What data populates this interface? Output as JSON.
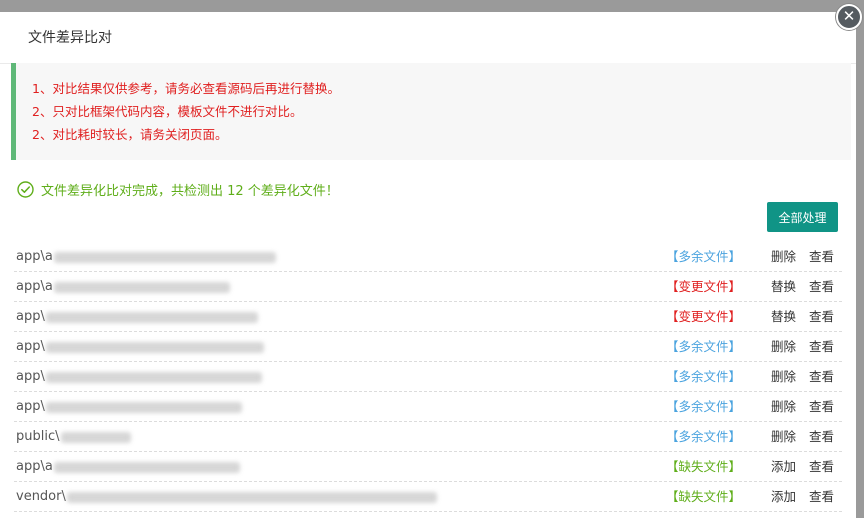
{
  "modal": {
    "title": "文件差异比对",
    "close_label": "✕"
  },
  "notice": {
    "lines": [
      "1、对比结果仅供参考，请务必查看源码后再进行替换。",
      "2、只对比框架代码内容，模板文件不进行对比。",
      "2、对比耗时较长，请务关闭页面。"
    ]
  },
  "status": {
    "message": "文件差异化比对完成，共检测出 12 个差异化文件！"
  },
  "toolbar": {
    "process_all_label": "全部处理"
  },
  "rows": [
    {
      "prefix": "app\\a",
      "tag": "【多余文件】",
      "tag_type": "extra",
      "action": "删除",
      "view": "查看"
    },
    {
      "prefix": "app\\a",
      "tag": "【变更文件】",
      "tag_type": "changed",
      "action": "替换",
      "view": "查看"
    },
    {
      "prefix": "app\\",
      "tag": "【变更文件】",
      "tag_type": "changed",
      "action": "替换",
      "view": "查看"
    },
    {
      "prefix": "app\\",
      "tag": "【多余文件】",
      "tag_type": "extra",
      "action": "删除",
      "view": "查看"
    },
    {
      "prefix": "app\\",
      "tag": "【多余文件】",
      "tag_type": "extra",
      "action": "删除",
      "view": "查看"
    },
    {
      "prefix": "app\\",
      "tag": "【多余文件】",
      "tag_type": "extra",
      "action": "删除",
      "view": "查看"
    },
    {
      "prefix": "public\\",
      "tag": "【多余文件】",
      "tag_type": "extra",
      "action": "删除",
      "view": "查看"
    },
    {
      "prefix": "app\\a",
      "tag": "【缺失文件】",
      "tag_type": "missing",
      "action": "添加",
      "view": "查看"
    },
    {
      "prefix": "vendor\\",
      "tag": "【缺失文件】",
      "tag_type": "missing",
      "action": "添加",
      "view": "查看"
    }
  ],
  "colors": {
    "accent": "#109486",
    "notice_border": "#5fb878",
    "warning_text": "#e02020",
    "success_text": "#5fae1a",
    "extra_tag": "#4aa3df",
    "changed_tag": "#e02020",
    "missing_tag": "#5fae1a"
  }
}
